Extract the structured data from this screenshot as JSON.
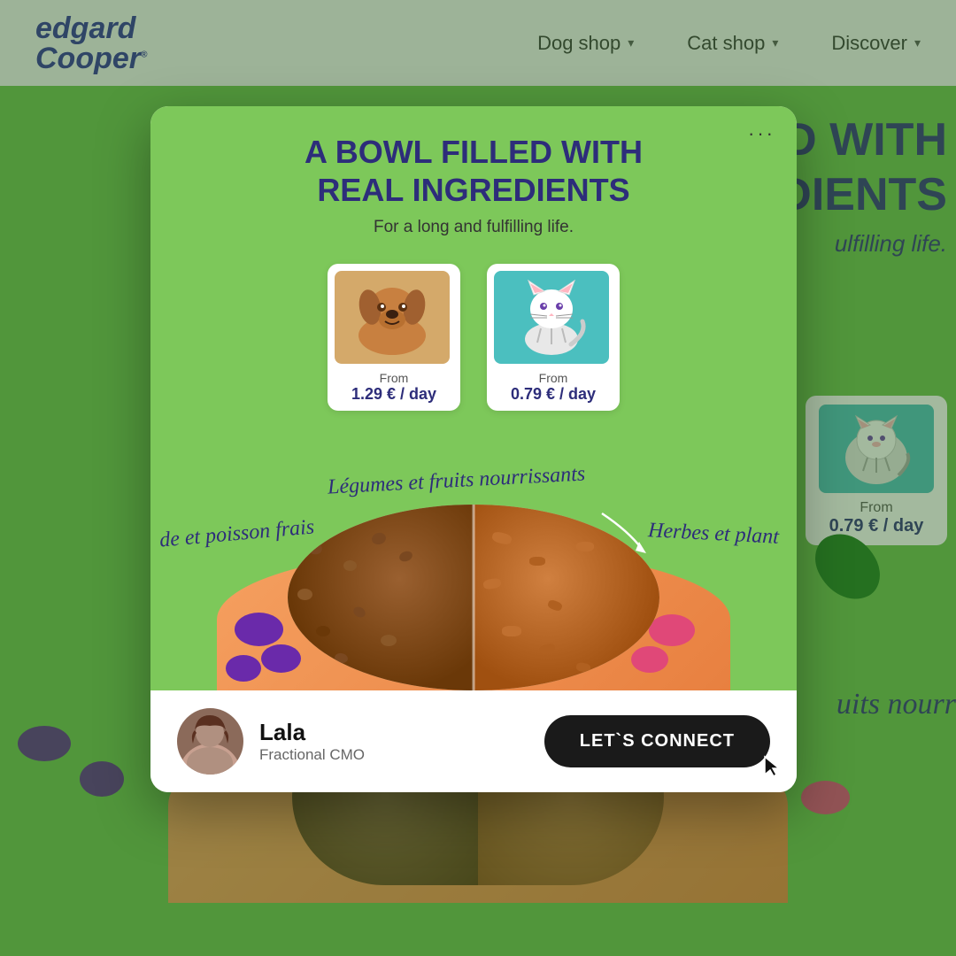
{
  "navbar": {
    "logo_line1": "edgard",
    "logo_line2": "Cooper",
    "nav_items": [
      {
        "label": "Dog shop",
        "id": "dog-shop"
      },
      {
        "label": "Cat shop",
        "id": "cat-shop"
      },
      {
        "label": "Discover",
        "id": "discover"
      }
    ]
  },
  "background": {
    "heading_line1": "A BOWL FILLED WITH",
    "heading_line2": "REAL INGREDIENTS",
    "subtitle": "For a long and fulfilling life.",
    "bg_partial_text1": "LED WITH",
    "bg_partial_text2": "EDIENTS",
    "bg_partial_sub": "ulfilling life.",
    "bg_cat_from": "From",
    "bg_cat_price": "0.79 € / day",
    "bg_handwritten1": "uits nourr",
    "bg_handwritten_left": "de et poisson frais",
    "bg_handwritten_center": "Légumes et fruits nourrissants",
    "bg_handwritten_right": "Herbes et plant"
  },
  "modal": {
    "dots_label": "···",
    "title_line1": "A BOWL FILLED WITH",
    "title_line2": "REAL INGREDIENTS",
    "subtitle": "For a long and fulfilling life.",
    "dog_card": {
      "from_label": "From",
      "price": "1.29 € / day"
    },
    "cat_card": {
      "from_label": "From",
      "price": "0.79 € / day"
    },
    "handwritten_left": "de et poisson frais",
    "handwritten_center": "Légumes et fruits nourrissants",
    "handwritten_right": "Herbes et plant",
    "profile": {
      "name": "Lala",
      "title": "Fractional CMO"
    },
    "connect_button": "LET`S CONNECT"
  }
}
